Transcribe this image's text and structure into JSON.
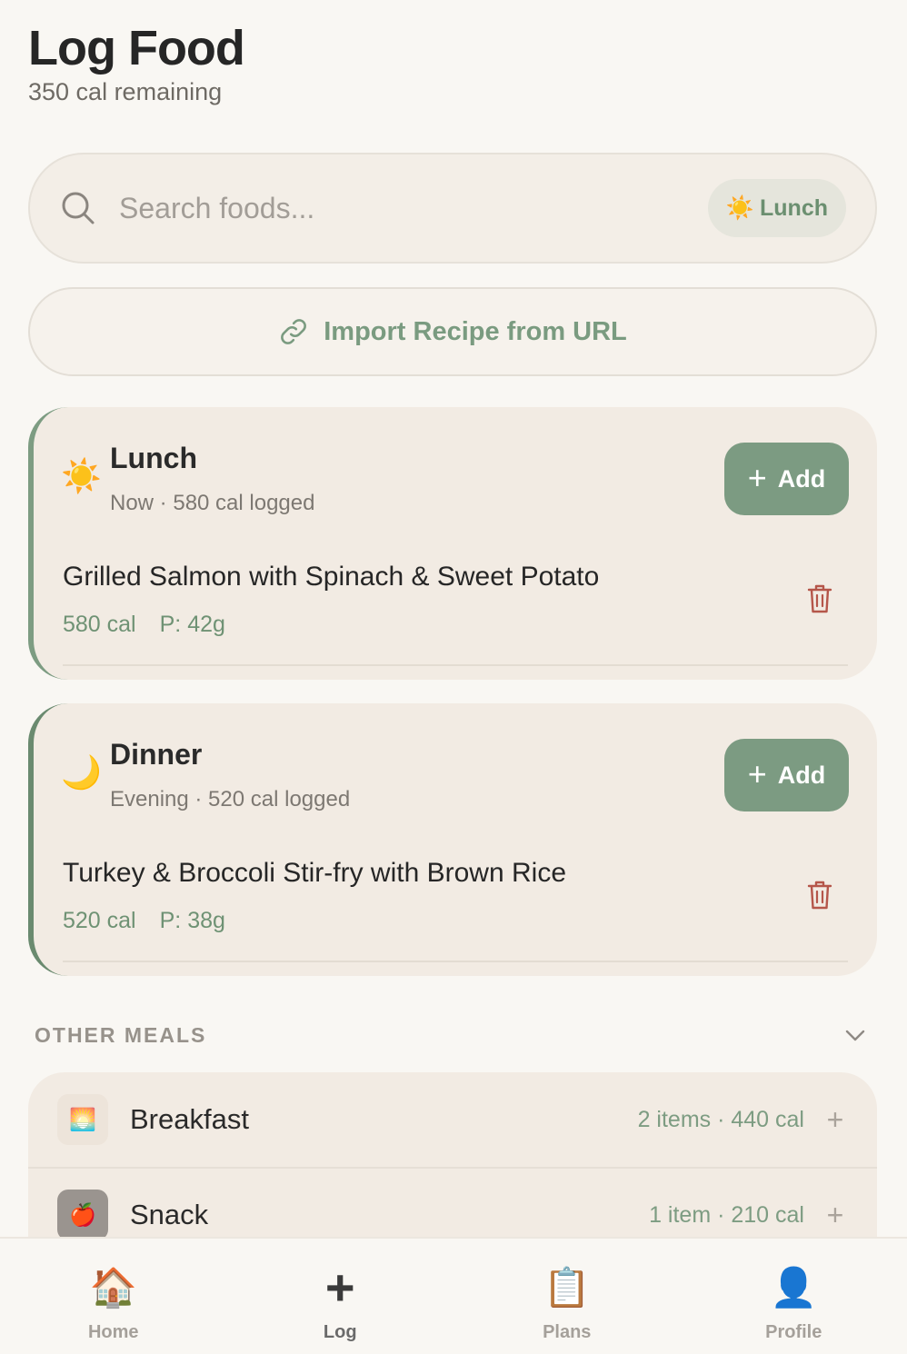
{
  "header": {
    "title": "Log Food",
    "subtitle": "350 cal remaining"
  },
  "search": {
    "placeholder": "Search foods...",
    "meal_chip_emoji": "☀️",
    "meal_chip_label": "Lunch"
  },
  "import_button": {
    "label": "Import Recipe from URL"
  },
  "meals": [
    {
      "emoji": "☀️",
      "name": "Lunch",
      "subtitle": "Now · 580 cal logged",
      "add_label": "Add",
      "food": {
        "name": "Grilled Salmon with Spinach & Sweet Potato",
        "calories": "580 cal",
        "protein": "P: 42g"
      }
    },
    {
      "emoji": "🌙",
      "name": "Dinner",
      "subtitle": "Evening · 520 cal logged",
      "add_label": "Add",
      "food": {
        "name": "Turkey & Broccoli Stir-fry with Brown Rice",
        "calories": "520 cal",
        "protein": "P: 38g"
      }
    }
  ],
  "other_meals": {
    "title": "OTHER MEALS",
    "items": [
      {
        "emoji": "🌅",
        "name": "Breakfast",
        "meta": "2 items · 440 cal"
      },
      {
        "emoji": "🍎",
        "name": "Snack",
        "meta": "1 item · 210 cal"
      }
    ]
  },
  "tabbar": {
    "items": [
      {
        "icon": "🏠",
        "label": "Home"
      },
      {
        "icon": "+",
        "label": "Log"
      },
      {
        "icon": "📋",
        "label": "Plans"
      },
      {
        "icon": "👤",
        "label": "Profile"
      }
    ]
  },
  "colors": {
    "accent": "#7c9b82",
    "background": "#f9f7f3",
    "card": "#f2ebe3",
    "delete": "#b5564a"
  }
}
